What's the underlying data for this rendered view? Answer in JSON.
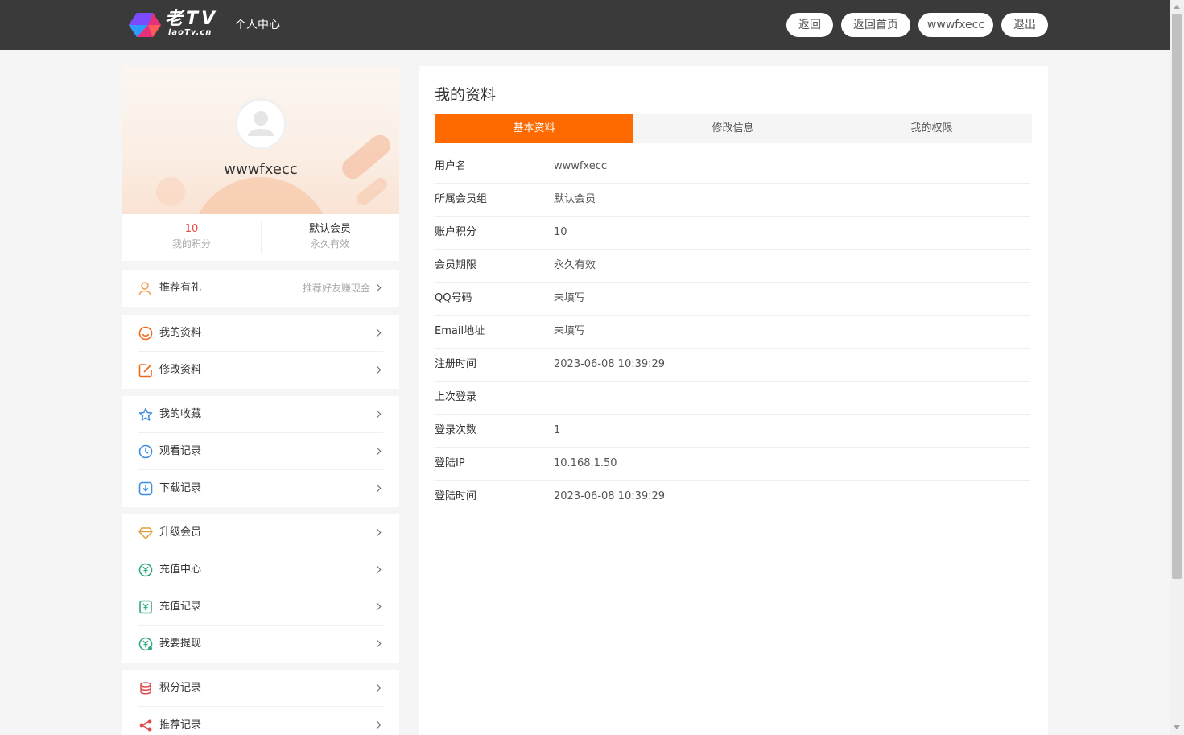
{
  "header": {
    "logo_text": "老TV",
    "logo_sub": "laoTv.cn",
    "title": "个人中心",
    "buttons": [
      "返回",
      "返回首页",
      "wwwfxecc",
      "退出"
    ]
  },
  "profile": {
    "username": "wwwfxecc",
    "points_value": "10",
    "points_label": "我的积分",
    "group_value": "默认会员",
    "group_label": "永久有效"
  },
  "menu": {
    "referral": {
      "label": "推荐有礼",
      "hint": "推荐好友赚现金"
    },
    "items": [
      "我的资料",
      "修改资料",
      "我的收藏",
      "观看记录",
      "下载记录",
      "升级会员",
      "充值中心",
      "充值记录",
      "我要提现",
      "积分记录",
      "推荐记录"
    ]
  },
  "main": {
    "title": "我的资料",
    "tabs": [
      "基本资料",
      "修改信息",
      "我的权限"
    ],
    "rows": [
      {
        "key": "用户名",
        "value": "wwwfxecc"
      },
      {
        "key": "所属会员组",
        "value": "默认会员"
      },
      {
        "key": "账户积分",
        "value": "10"
      },
      {
        "key": "会员期限",
        "value": "永久有效"
      },
      {
        "key": "QQ号码",
        "value": "未填写"
      },
      {
        "key": "Email地址",
        "value": "未填写"
      },
      {
        "key": "注册时间",
        "value": "2023-06-08 10:39:29"
      },
      {
        "key": "上次登录",
        "value": ""
      },
      {
        "key": "登录次数",
        "value": "1"
      },
      {
        "key": "登陆IP",
        "value": "10.168.1.50"
      },
      {
        "key": "登陆时间",
        "value": "2023-06-08 10:39:29"
      }
    ]
  },
  "colors": {
    "accent": "#ff6a00",
    "topbar": "#3a3a3a",
    "points": "#e0484a"
  }
}
